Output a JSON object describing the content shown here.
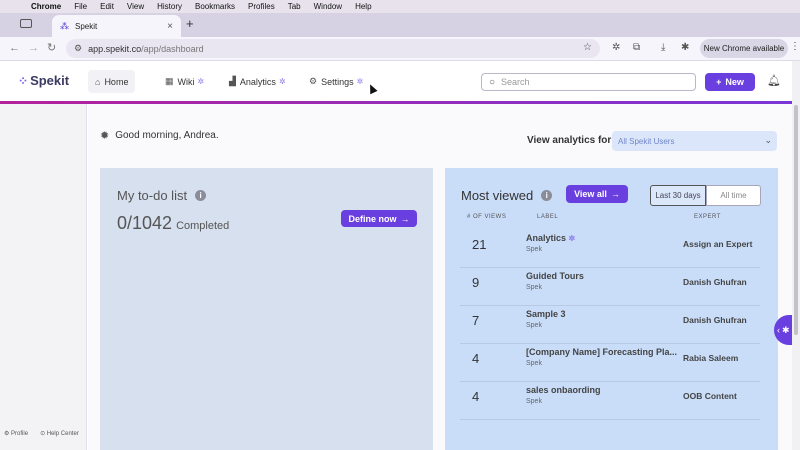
{
  "menubar": {
    "items": [
      "Chrome",
      "File",
      "Edit",
      "View",
      "History",
      "Bookmarks",
      "Profiles",
      "Tab",
      "Window",
      "Help"
    ]
  },
  "browser": {
    "tab_title": "Spekit",
    "url_host": "app.spekit.co",
    "url_path": "/app/dashboard",
    "update_label": "New Chrome available"
  },
  "header": {
    "logo": "Spekit",
    "nav": [
      {
        "label": "Home"
      },
      {
        "label": "Wiki"
      },
      {
        "label": "Analytics"
      },
      {
        "label": "Settings"
      }
    ],
    "search_placeholder": "Search",
    "new_label": "New"
  },
  "sidebar": {
    "profile": "Profile",
    "help": "Help Center"
  },
  "greeting": "Good morning, Andrea.",
  "view_analytics": {
    "label": "View analytics for",
    "value": "All Spekit Users"
  },
  "todo": {
    "title": "My to-do list",
    "count": "0/1042",
    "completed": "Completed",
    "define_label": "Define now"
  },
  "most_viewed": {
    "title": "Most viewed",
    "view_all": "View all",
    "range_active": "Last 30 days",
    "range_other": "All time",
    "col_views": "# OF VIEWS",
    "col_label": "LABEL",
    "col_expert": "EXPERT",
    "rows": [
      {
        "views": "21",
        "label": "Analytics",
        "sub": "Spek",
        "expert": "Assign an Expert"
      },
      {
        "views": "9",
        "label": "Guided Tours",
        "sub": "Spek",
        "expert": "Danish Ghufran"
      },
      {
        "views": "7",
        "label": "Sample 3",
        "sub": "Spek",
        "expert": "Danish Ghufran"
      },
      {
        "views": "4",
        "label": "[Company Name] Forecasting Pla...",
        "sub": "Spek",
        "expert": "Rabia Saleem"
      },
      {
        "views": "4",
        "label": "sales onbaording",
        "sub": "Spek",
        "expert": "OOB Content"
      }
    ]
  },
  "colors": {
    "accent": "#6a3fe0",
    "brand_gradient_start": "#b3219b",
    "todo_bg": "#d6e0ee",
    "mv_bg": "#c9ddf9"
  }
}
